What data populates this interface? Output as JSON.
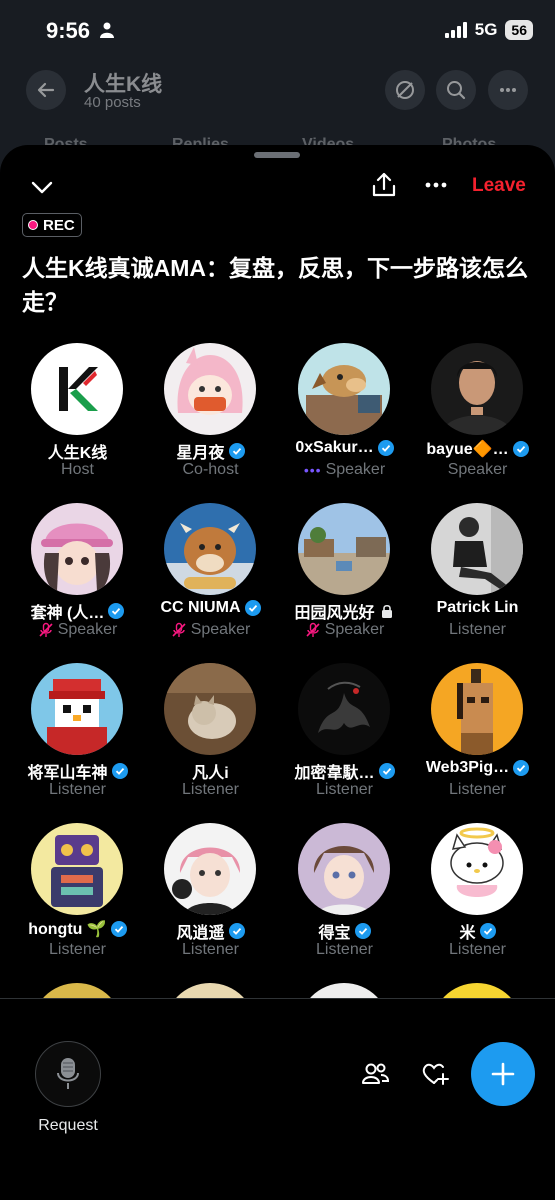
{
  "status_bar": {
    "time": "9:56",
    "network": "5G",
    "battery": "56"
  },
  "profile": {
    "name": "人生K线",
    "posts": "40 posts",
    "tabs": [
      "Posts",
      "Replies",
      "Videos",
      "Photos"
    ]
  },
  "space": {
    "rec_label": "REC",
    "title": "人生K线真诚AMA：复盘，反思，下一步路该怎么走？",
    "leave_label": "Leave"
  },
  "participants": [
    {
      "name": "人生K线",
      "role": "Host",
      "verified": false,
      "avatar": "kline-logo"
    },
    {
      "name": "星月夜",
      "role": "Co-host",
      "verified": true,
      "avatar": "pink-hair-character"
    },
    {
      "name": "0xSakur…",
      "role": "Speaker",
      "verified": true,
      "speaking": true,
      "avatar": "cartoon-dog"
    },
    {
      "name": "bayue🔶…",
      "role": "Speaker",
      "verified": true,
      "avatar": "man-portrait"
    },
    {
      "name": "套神 (人…",
      "role": "Speaker",
      "verified": true,
      "muted": true,
      "avatar": "girl-pink-cap"
    },
    {
      "name": "CC NIUMA",
      "role": "Speaker",
      "verified": true,
      "muted": true,
      "avatar": "plush-cow"
    },
    {
      "name": "田园风光好",
      "role": "Speaker",
      "verified": false,
      "locked": true,
      "muted": true,
      "avatar": "courtyard-photo"
    },
    {
      "name": "Patrick Lin",
      "role": "Listener",
      "verified": false,
      "avatar": "person-sitting"
    },
    {
      "name": "将军山车神",
      "role": "Listener",
      "verified": true,
      "avatar": "pixel-penguin"
    },
    {
      "name": "凡人i",
      "role": "Listener",
      "verified": false,
      "avatar": "cat-photo"
    },
    {
      "name": "加密韋馱…",
      "role": "Listener",
      "verified": true,
      "avatar": "dark-dragon"
    },
    {
      "name": "Web3Pig…",
      "role": "Listener",
      "verified": true,
      "avatar": "pixel-punk"
    },
    {
      "name": "hongtu 🌱",
      "role": "Listener",
      "verified": true,
      "avatar": "robot-art"
    },
    {
      "name": "风逍遥",
      "role": "Listener",
      "verified": true,
      "avatar": "anime-boy-headphones"
    },
    {
      "name": "得宝",
      "role": "Listener",
      "verified": true,
      "avatar": "anime-boy-brown"
    },
    {
      "name": "米",
      "role": "Listener",
      "verified": true,
      "avatar": "hello-kitty-angel"
    }
  ],
  "bottom_bar": {
    "request_label": "Request"
  },
  "colors": {
    "accent": "#1d9bf0",
    "leave": "#f4212e",
    "rec": "#f91880",
    "muted_text": "#71767b"
  }
}
